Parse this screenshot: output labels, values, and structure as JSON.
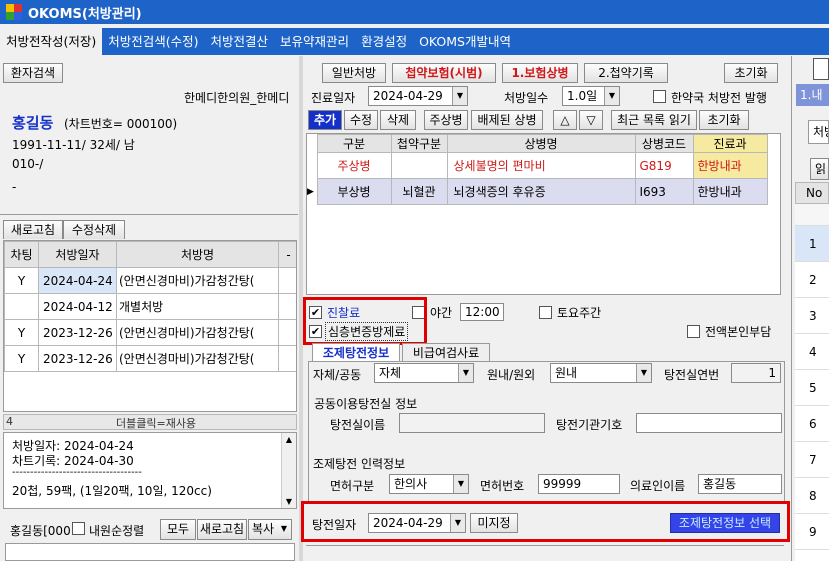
{
  "window": {
    "title": "OKOMS(처방관리)"
  },
  "menu": [
    "처방전작성(저장)",
    "처방전검색(수정)",
    "처방전결산",
    "보유약재관리",
    "환경설정",
    "OKOMS개발내역"
  ],
  "patient": {
    "search_button": "환자검색",
    "clinic": "한메디한의원_한메디",
    "name": "홍길동",
    "chart_no": "(차트번호= 000100)",
    "dob": "1991-11-11/ 32세/ 남",
    "phone": "010-/",
    "misc": "-"
  },
  "rx_list": {
    "refresh_tab": "새로고침",
    "edit_delete_tab": "수정삭제",
    "headers": [
      "차팅",
      "처방일자",
      "처방명",
      "-"
    ],
    "rows": [
      {
        "chart": "Y",
        "date": "2024-04-24",
        "name": "(안면신경마비)가감청간탕("
      },
      {
        "chart": "",
        "date": "2024-04-12",
        "name": "개별처방"
      },
      {
        "chart": "Y",
        "date": "2023-12-26",
        "name": "(안면신경마비)가감청간탕("
      },
      {
        "chart": "Y",
        "date": "2023-12-26",
        "name": "(안면신경마비)가감청간탕("
      }
    ],
    "count": "4",
    "hint": "더블클릭=재사용"
  },
  "memo": {
    "line1": "처방일자: 2024-04-24",
    "line2": "차트기록: 2024-04-30",
    "line3": "------------------------------------",
    "line4": "20첩, 59팩, (1일20팩, 10일, 120cc)"
  },
  "bottom_left": {
    "label": "홍길동[000",
    "check_label": "내원순정렬",
    "all_button": "모두",
    "refresh_button": "새로고침",
    "copy_button": "복사"
  },
  "rx_tabs": {
    "general": "일반처방",
    "insurance": "첩약보험(시범)",
    "ins_disease": "1.보험상병",
    "ins_record": "2.첩약기록",
    "reset": "초기화"
  },
  "rx_form": {
    "date_label": "진료일자",
    "date": "2024-04-29",
    "days_label": "처방일수",
    "days": "1.0일",
    "inhouse_label": "한약국 처방전 발행"
  },
  "toolbar": {
    "add": "추가",
    "edit": "수정",
    "delete": "삭제",
    "main_disease": "주상병",
    "excluded": "배제된 상병",
    "up": "△",
    "down": "▽",
    "recent": "최근 목록 읽기",
    "reset": "초기화"
  },
  "disease_table": {
    "headers": [
      "구분",
      "첩약구분",
      "상병명",
      "상병코드",
      "진료과"
    ],
    "rows": [
      {
        "type": "주상병",
        "category": "",
        "name": "상세불명의  편마비",
        "code": "G819",
        "dept": "한방내과"
      },
      {
        "type": "부상병",
        "category": "뇌혈관",
        "name": "뇌경색증의  후유증",
        "code": "I693",
        "dept": "한방내과"
      }
    ]
  },
  "fees": {
    "consult": "진찰료",
    "night": "야간",
    "night_time": "12:00",
    "saturday": "토요주간",
    "synd_diff": "심층변증방제료",
    "full_self": "전액본인부담"
  },
  "decoct_tabs": {
    "info": "조제탕전정보",
    "non_pay": "비급여검사료"
  },
  "decoct": {
    "self_label": "자체/공동",
    "self_value": "자체",
    "inout_label": "원내/원외",
    "inout_value": "원내",
    "serial_label": "탕전실연번",
    "serial_value": "1",
    "shared_title": "공동이용탕전실 정보",
    "room_name_label": "탕전실이름",
    "room_code_label": "탕전기관기호",
    "input_title": "조제탕전 인력정보",
    "license_type_label": "면허구분",
    "license_type": "한의사",
    "license_no_label": "면허번호",
    "license_no": "99999",
    "person_label": "의료인이름",
    "person": "홍길동",
    "date_label": "탕전일자",
    "date": "2024-04-29",
    "undecided": "미지정",
    "select_button": "조제탕전정보 선택"
  },
  "right": {
    "tab": "1.내",
    "rx_label": "처방",
    "read_label": "읽",
    "no_header": "No",
    "numbers": [
      "1",
      "2",
      "3",
      "4",
      "5",
      "6",
      "7",
      "8",
      "9"
    ]
  },
  "colors": {
    "menu_bg": "#1e64c8",
    "highlight_blue": "#1530c8",
    "red_text": "#d01818",
    "red_box": "#e00000",
    "row2_bg": "#dcdcf0",
    "dept_bg": "#f5eaa0"
  }
}
